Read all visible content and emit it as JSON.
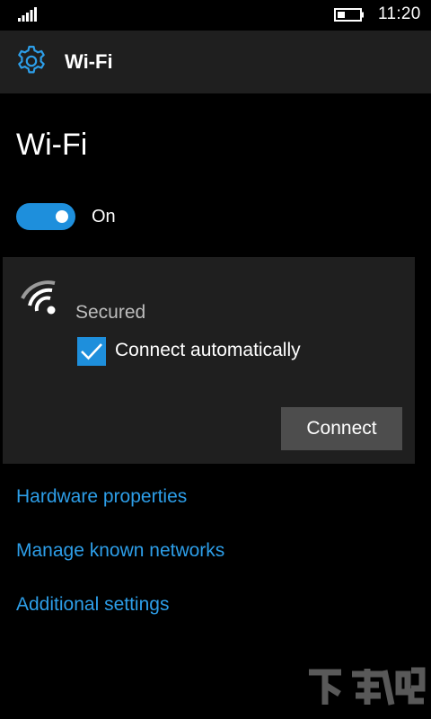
{
  "status_bar": {
    "time": "11:20",
    "signal_icon": "signal-bars-icon",
    "battery_icon": "battery-icon"
  },
  "header": {
    "icon": "gear-icon",
    "title": "Wi-Fi"
  },
  "page": {
    "title": "Wi-Fi"
  },
  "wifi_toggle": {
    "state_label": "On",
    "on": true
  },
  "network": {
    "icon": "wifi-signal-icon",
    "status": "Secured",
    "auto_connect_label": "Connect automatically",
    "auto_connect_checked": true,
    "connect_label": "Connect"
  },
  "links": {
    "hardware_properties": "Hardware properties",
    "manage_known_networks": "Manage known networks",
    "additional_settings": "Additional settings"
  },
  "watermark": {
    "text": "下载吧"
  },
  "colors": {
    "background": "#000000",
    "panel": "#1f1f1f",
    "accent": "#1e8fdc",
    "link": "#2d9ee8",
    "button": "#4d4d4d",
    "secondary_text": "#bdbdbd"
  }
}
